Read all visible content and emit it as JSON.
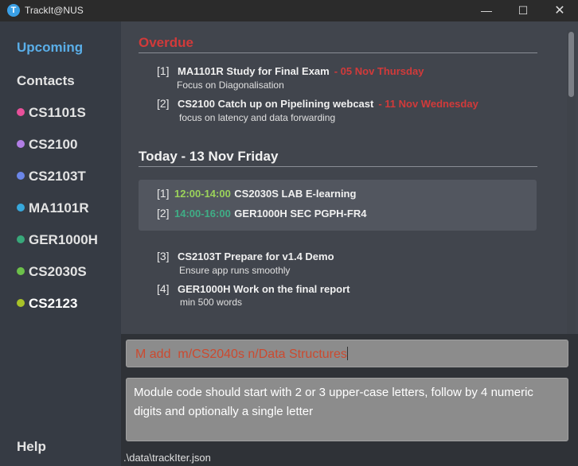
{
  "window": {
    "title": "TrackIt@NUS",
    "icon_letter": "T"
  },
  "sidebar": {
    "items": [
      {
        "label": "Upcoming",
        "active": true
      },
      {
        "label": "Contacts"
      },
      {
        "label": "CS1101S",
        "color": "#e8509a"
      },
      {
        "label": "CS2100",
        "color": "#b27ee6"
      },
      {
        "label": "CS2103T",
        "color": "#6b86e8"
      },
      {
        "label": "MA1101R",
        "color": "#37a8dc"
      },
      {
        "label": "GER1000H",
        "color": "#38a87a"
      },
      {
        "label": "CS2030S",
        "color": "#6cc04a"
      },
      {
        "label": "CS2123",
        "color": "#a8c228"
      }
    ],
    "help": "Help"
  },
  "overdue": {
    "title": "Overdue",
    "tasks": [
      {
        "index": "[1]",
        "name": "MA1101R Study for Final Exam",
        "date": "- 05 Nov Thursday",
        "desc": "Focus on Diagonalisation"
      },
      {
        "index": "[2]",
        "name": "CS2100 Catch up on Pipelining webcast",
        "date": "- 11 Nov Wednesday",
        "desc": "focus on latency and data forwarding"
      }
    ]
  },
  "today": {
    "title": "Today - 13 Nov Friday",
    "lessons": [
      {
        "index": "[1]",
        "time": "12:00-14:00",
        "time_color": "#9bd35a",
        "name": "CS2030S LAB E-learning"
      },
      {
        "index": "[2]",
        "time": "14:00-16:00",
        "time_color": "#3fae86",
        "name": "GER1000H SEC PGPH-FR4"
      }
    ],
    "tasks": [
      {
        "index": "[3]",
        "name": "CS2103T Prepare for v1.4 Demo",
        "desc": "Ensure app runs smoothly"
      },
      {
        "index": "[4]",
        "name": "GER1000H Work on the final report",
        "desc": "min 500 words"
      }
    ]
  },
  "command": {
    "value": "M add  m/CS2040s n/Data Structures"
  },
  "result": {
    "text": "Module code should start with 2 or 3 upper-case letters, follow by 4 numeric digits and optionally a single letter"
  },
  "status": {
    "path": ".\\data\\trackIter.json"
  },
  "colors": {
    "overdue": "#d23a3a",
    "accent": "#5aaee8"
  }
}
